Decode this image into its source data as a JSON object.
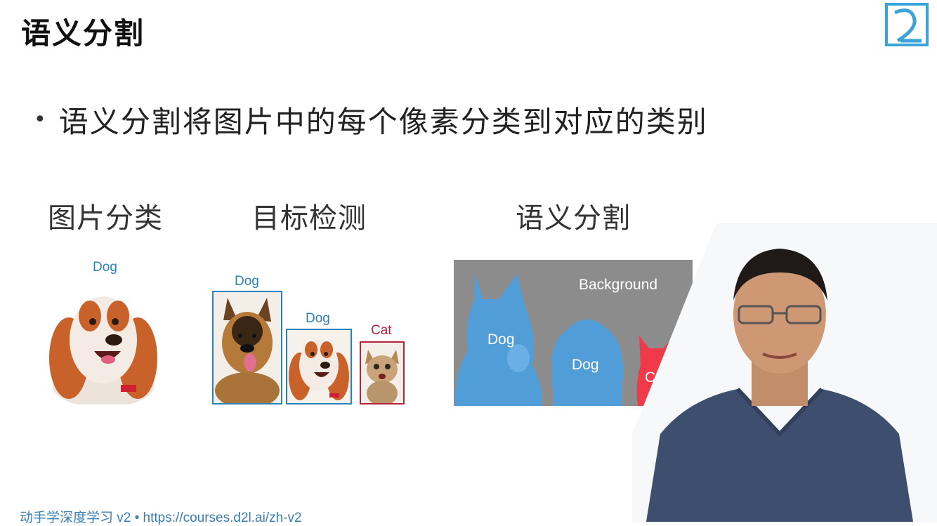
{
  "slide": {
    "title": "语义分割",
    "bullet": "语义分割将图片中的每个像素分类到对应的类别"
  },
  "columns": [
    {
      "label": "图片分类"
    },
    {
      "label": "目标检测"
    },
    {
      "label": "语义分割"
    }
  ],
  "classification": {
    "label": "Dog"
  },
  "detection": {
    "boxes": [
      {
        "label": "Dog"
      },
      {
        "label": "Dog"
      },
      {
        "label": "Cat"
      }
    ]
  },
  "segmentation": {
    "background_label": "Background",
    "labels": [
      "Dog",
      "Dog",
      "Cat"
    ]
  },
  "footer": "动手学深度学习 v2 • https://courses.d2l.ai/zh-v2",
  "colors": {
    "box_blue": "#2a82b8",
    "box_red": "#b8233c",
    "seg_blue": "#4a9fe0",
    "seg_red": "#f03a4a",
    "seg_bg": "#8c8c8c"
  },
  "icons": [
    "d2l-logo-icon",
    "dog-image",
    "cat-image",
    "presenter-photo"
  ]
}
